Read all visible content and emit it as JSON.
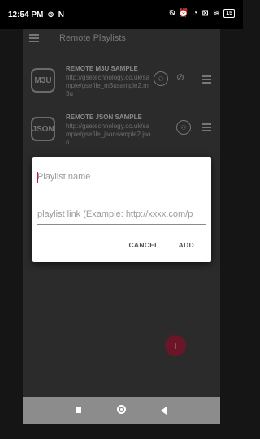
{
  "status_bar": {
    "time": "12:54 PM",
    "left_icons": [
      "cast-icon",
      "n-icon"
    ],
    "right_icons": [
      "alarm-off-icon",
      "alarm-icon",
      "data-saver-icon",
      "close-box-icon",
      "wifi-icon"
    ],
    "battery": "15"
  },
  "toolbar": {
    "title": "Remote Playlists"
  },
  "playlists": [
    {
      "badge": "M3U",
      "title": "REMOTE M3U SAMPLE",
      "url": "http://gsetechnology.co.uk/sample/gsefile_m3usample2.m3u"
    },
    {
      "badge": "JSON",
      "title": "REMOTE JSON SAMPLE",
      "url": "http://gsetechnology.co.uk/sample/gsefile_jsonsample2.json"
    }
  ],
  "dialog": {
    "name_placeholder": "Playlist name",
    "link_placeholder": "playlist link (Example: http://xxxx.com/p",
    "cancel_label": "CANCEL",
    "add_label": "ADD"
  },
  "fab": {
    "label": "+"
  },
  "colors": {
    "accent": "#c2185b",
    "fab": "#6a1628"
  }
}
